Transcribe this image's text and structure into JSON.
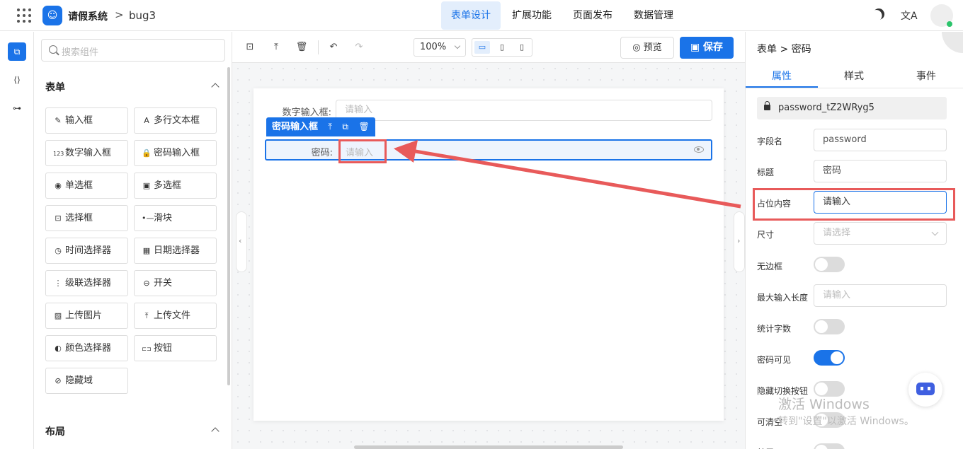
{
  "header": {
    "app_title": "请假系统",
    "crumb_sep": ">",
    "app_name": "bug3",
    "tabs": [
      {
        "label": "表单设计",
        "active": true
      },
      {
        "label": "扩展功能",
        "active": false
      },
      {
        "label": "页面发布",
        "active": false
      },
      {
        "label": "数据管理",
        "active": false
      }
    ],
    "lang_icon": "文A",
    "accent": "#1a73e8"
  },
  "left_panel": {
    "search_placeholder": "搜索组件",
    "form_section": "表单",
    "layout_section": "布局",
    "components": [
      {
        "icon": "✎",
        "label": "输入框"
      },
      {
        "icon": "A",
        "label": "多行文本框"
      },
      {
        "icon": "123",
        "label": "数字输入框"
      },
      {
        "icon": "🔒",
        "label": "密码输入框"
      },
      {
        "icon": "◉",
        "label": "单选框"
      },
      {
        "icon": "▣",
        "label": "多选框"
      },
      {
        "icon": "⊡",
        "label": "选择框"
      },
      {
        "icon": "•—",
        "label": "滑块"
      },
      {
        "icon": "◷",
        "label": "时间选择器"
      },
      {
        "icon": "▦",
        "label": "日期选择器"
      },
      {
        "icon": "⋮",
        "label": "级联选择器"
      },
      {
        "icon": "⊖",
        "label": "开关"
      },
      {
        "icon": "▨",
        "label": "上传图片"
      },
      {
        "icon": "⤒",
        "label": "上传文件"
      },
      {
        "icon": "◐",
        "label": "颜色选择器"
      },
      {
        "icon": "⊏⊐",
        "label": "按钮"
      },
      {
        "icon": "⊘",
        "label": "隐藏域"
      }
    ]
  },
  "toolbar": {
    "zoom": "100%",
    "preview_label": "预览",
    "save_label": "保存"
  },
  "canvas": {
    "field1_label": "数字输入框:",
    "field1_placeholder": "请输入",
    "selected_tag": "密码输入框",
    "tag_actions": [
      "⤒",
      "⧉",
      "🗑"
    ],
    "field2_label": "密码:",
    "field2_placeholder": "请输入"
  },
  "properties": {
    "breadcrumb": "表单 > 密码",
    "tabs": [
      "属性",
      "样式",
      "事件"
    ],
    "field_id": "password_tZ2WRyg5",
    "rows": {
      "field_name_label": "字段名",
      "field_name_value": "password",
      "title_label": "标题",
      "title_value": "密码",
      "placeholder_label": "占位内容",
      "placeholder_value": "请输入",
      "size_label": "尺寸",
      "size_placeholder": "请选择",
      "no_border_label": "无边框",
      "maxlen_label": "最大输入长度",
      "maxlen_placeholder": "请输入",
      "count_label": "统计字数",
      "visible_label": "密码可见",
      "hide_toggle_label": "隐藏切换按钮",
      "clearable_label": "可清空",
      "disabled_label": "禁用"
    },
    "toggles": {
      "no_border": false,
      "count": false,
      "visible": true,
      "hide_toggle": false,
      "clearable": false
    },
    "watermark_line1": "激活 Windows",
    "watermark_line2": "转到\"设置\"以激活 Windows。"
  }
}
